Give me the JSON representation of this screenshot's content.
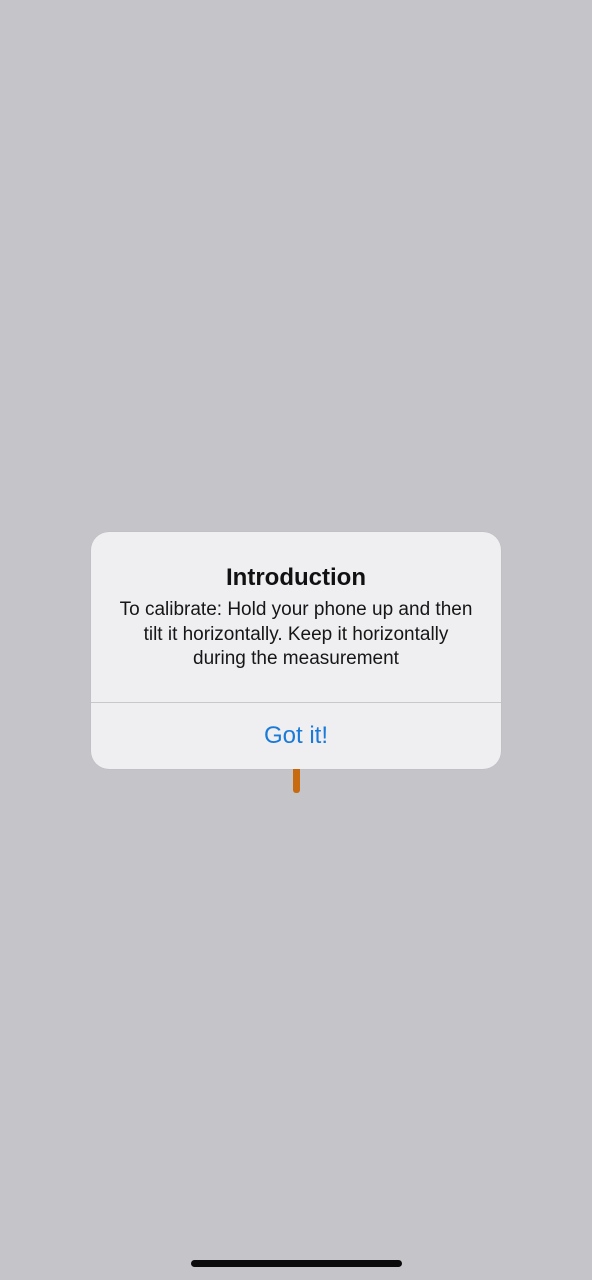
{
  "alert": {
    "title": "Introduction",
    "message": "To calibrate: Hold your phone up and then tilt it horizontally. Keep it horizontally during the measurement",
    "button_label": "Got it!"
  },
  "colors": {
    "background": "#c5c4c9",
    "alert_background": "#efeef1",
    "accent": "#1a7ad8",
    "needle": "#c86a10"
  }
}
